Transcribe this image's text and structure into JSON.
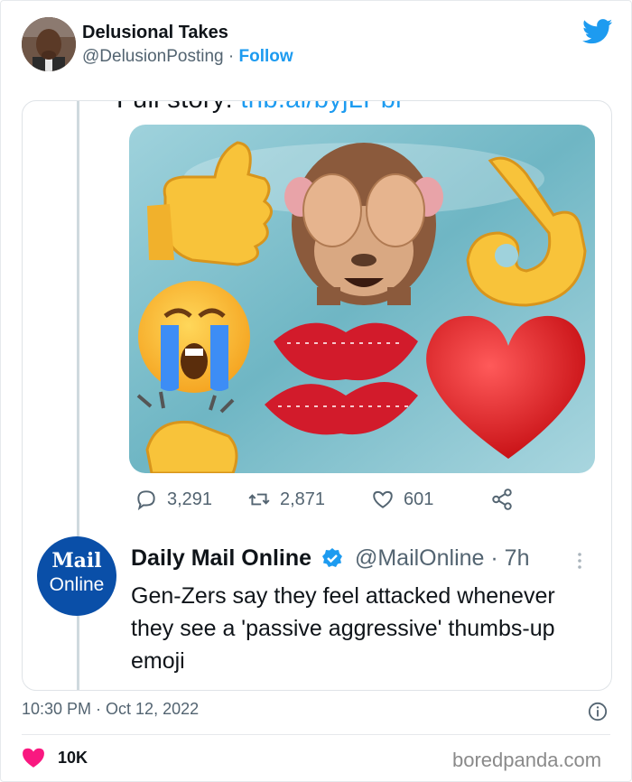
{
  "author": {
    "name": "Delusional Takes",
    "handle": "@DelusionPosting",
    "separator": "·",
    "follow_label": "Follow"
  },
  "quoted_screenshot": {
    "cut_text_prefix": "Full story: ",
    "cut_link": "trib.al/byjLPbl",
    "stats": {
      "replies": "3,291",
      "retweets": "2,871",
      "likes": "601"
    },
    "quote": {
      "logo_line1": "Mail",
      "logo_line2": "Online",
      "name": "Daily Mail Online",
      "handle": "@MailOnline · 7h",
      "text": "Gen-Zers say they feel attacked whenever they see a 'passive aggressive' thumbs-up emoji"
    },
    "emoji_image": [
      "thumbs-up",
      "see-no-evil-monkey",
      "ok-hand",
      "loudly-crying-face",
      "kiss-mark",
      "red-heart",
      "clapping-hands"
    ]
  },
  "footer": {
    "timestamp": "10:30 PM · Oct 12, 2022",
    "like_count": "10K",
    "watermark": "boredpanda.com"
  },
  "colors": {
    "twitter_blue": "#1d9bf0",
    "daily_mail_blue": "#0a4fa8",
    "heart_pink": "#f91880",
    "muted_text": "#536471"
  }
}
